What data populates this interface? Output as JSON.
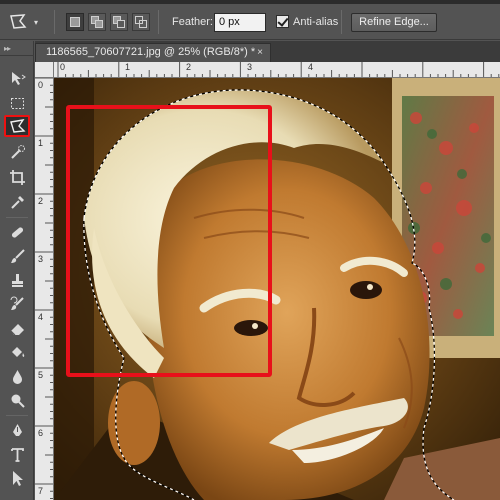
{
  "options_bar": {
    "tool_preset_icon": "polygonal-lasso-icon",
    "selection_modes": [
      "new-selection-icon",
      "add-to-selection-icon",
      "subtract-from-selection-icon",
      "intersect-selection-icon"
    ],
    "feather_label": "Feather:",
    "feather_value": "0 px",
    "anti_alias_label": "Anti-alias",
    "anti_alias_checked": true,
    "refine_edge_label": "Refine Edge..."
  },
  "document": {
    "tab_title": "1186565_70607721.jpg @ 25% (RGB/8*) *",
    "close_symbol": "×"
  },
  "rulers": {
    "top_numbers": [
      "0",
      "1",
      "2",
      "3",
      "4"
    ],
    "left_numbers": [
      "0",
      "1",
      "2",
      "3",
      "4",
      "5",
      "6",
      "7"
    ]
  },
  "toolbar": {
    "tools": [
      "move-icon",
      "marquee-icon",
      "polygonal-lasso-icon",
      "quick-selection-icon",
      "crop-icon",
      "eyedropper-icon",
      "healing-brush-icon",
      "brush-icon",
      "clone-stamp-icon",
      "history-brush-icon",
      "eraser-icon",
      "paint-bucket-icon",
      "blur-icon",
      "dodge-icon",
      "pen-icon",
      "type-icon",
      "path-selection-icon"
    ],
    "selected_tool": "polygonal-lasso-icon"
  },
  "colors": {
    "highlight": "#e8101a",
    "ui_dark": "#535353"
  }
}
